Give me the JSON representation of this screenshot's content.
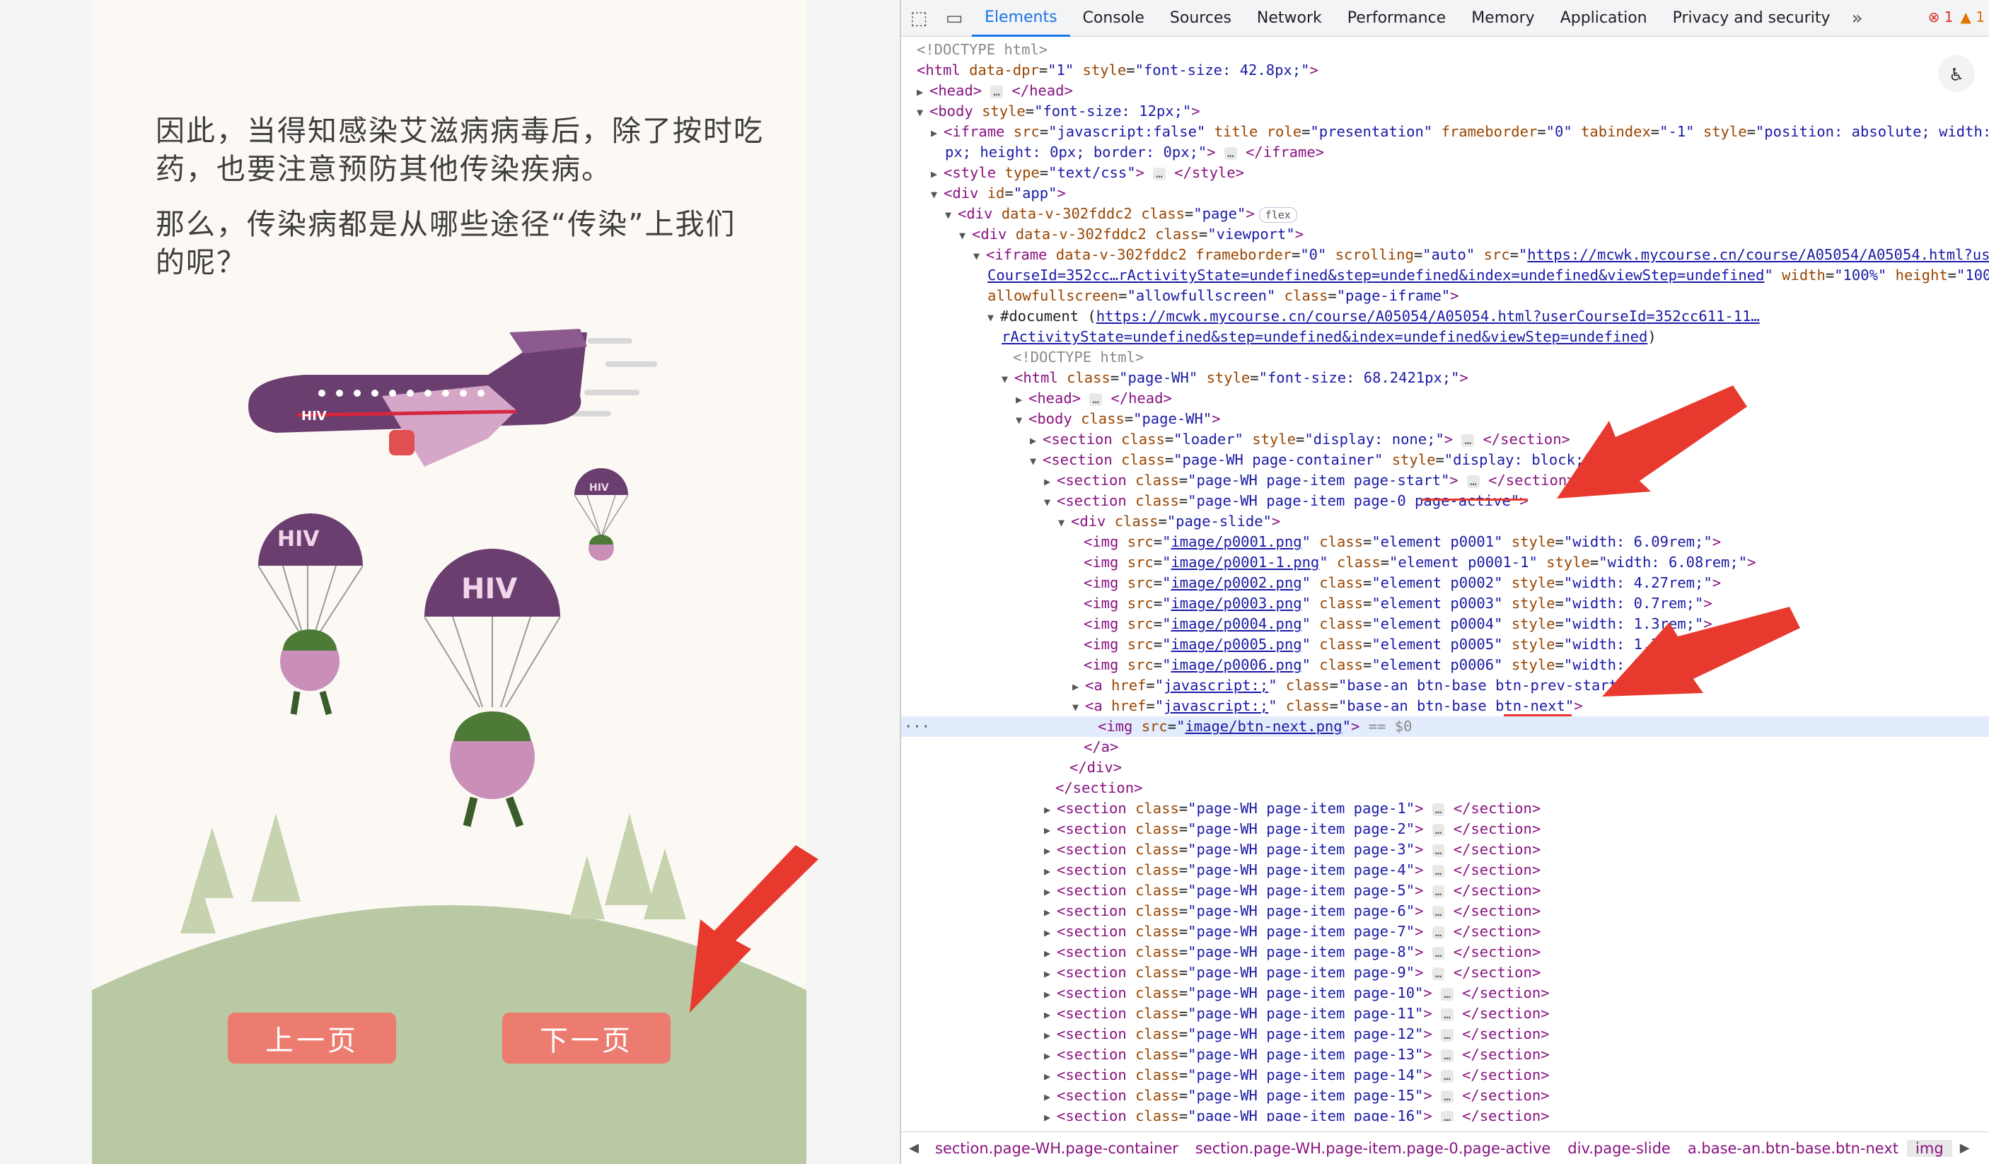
{
  "course_page": {
    "para1": "因此，当得知感染艾滋病病毒后，除了按时吃药，也要注意预防其他传染疾病。",
    "para2": "那么，传染病都是从哪些途径“传染”上我们的呢？",
    "plane_label": "HIV",
    "parachute_label": "HIV",
    "prev_label": "上一页",
    "next_label": "下一页"
  },
  "devtools": {
    "tabs": [
      "Elements",
      "Console",
      "Sources",
      "Network",
      "Performance",
      "Memory",
      "Application",
      "Privacy and security"
    ],
    "more": "»",
    "error_count": "1",
    "warning_count": "1",
    "selected_suffix": "== $0",
    "flex_badge": "flex",
    "ellipsis": "…",
    "breadcrumbs": [
      "section.page-WH.page-container",
      "section.page-WH.page-item.page-0.page-active",
      "div.page-slide",
      "a.base-an.btn-base.btn-next",
      "img"
    ]
  },
  "colors": {
    "accent": "#1a73e8",
    "button": "#ec7c6f",
    "arrow": "#e8392f",
    "hill": "#b9c9a3"
  }
}
